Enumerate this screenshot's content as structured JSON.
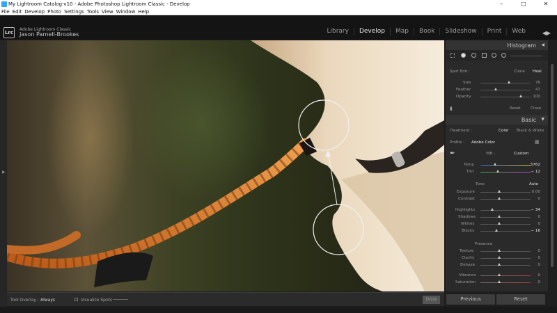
{
  "window": {
    "title": "My Lightroom Catalog-v10 - Adobe Photoshop Lightroom Classic - Develop",
    "minimize": "–",
    "maximize": "□",
    "close": "✕"
  },
  "menu": [
    "File",
    "Edit",
    "Develop",
    "Photo",
    "Settings",
    "Tools",
    "View",
    "Window",
    "Help"
  ],
  "identity": {
    "logo": "Lrc",
    "app_name": "Adobe Lightroom Classic",
    "user_name": "Jason Parnell-Brookes"
  },
  "modules": {
    "items": [
      "Library",
      "Develop",
      "Map",
      "Book",
      "Slideshow",
      "Print",
      "Web"
    ],
    "active": "Develop"
  },
  "toolbar": {
    "tool_overlay_label": "Tool Overlay :",
    "tool_overlay_value": "Always",
    "visualize_spots": "Visualize Spots",
    "done": "Done"
  },
  "panel": {
    "histogram": "Histogram",
    "spot_edit": {
      "label": "Spot Edit :",
      "clone": "Clone",
      "heal": "Heal",
      "size_label": "Size",
      "size_value": "76",
      "feather_label": "Feather",
      "feather_value": "47",
      "opacity_label": "Opacity",
      "opacity_value": "100",
      "reset": "Reset",
      "close": "Close"
    },
    "basic": {
      "title": "Basic",
      "treatment_label": "Treatment :",
      "color": "Color",
      "bw": "Black & White",
      "profile_label": "Profile :",
      "profile_value": "Adobe Color",
      "wb_label": "WB :",
      "wb_value": "Custom",
      "temp_label": "Temp",
      "temp_value": "5762",
      "tint_label": "Tint",
      "tint_value": "− 12",
      "tone_label": "Tone",
      "auto": "Auto",
      "exposure_label": "Exposure",
      "exposure_value": "0.00",
      "contrast_label": "Contrast",
      "contrast_value": "0",
      "highlights_label": "Highlights",
      "highlights_value": "− 34",
      "shadows_label": "Shadows",
      "shadows_value": "0",
      "whites_label": "Whites",
      "whites_value": "0",
      "blacks_label": "Blacks",
      "blacks_value": "− 16",
      "presence_label": "Presence",
      "texture_label": "Texture",
      "texture_value": "0",
      "clarity_label": "Clarity",
      "clarity_value": "0",
      "dehaze_label": "Dehaze",
      "dehaze_value": "0",
      "vibrance_label": "Vibrance",
      "vibrance_value": "0",
      "saturation_label": "Saturation",
      "saturation_value": "0"
    },
    "previous": "Previous",
    "reset": "Reset"
  }
}
